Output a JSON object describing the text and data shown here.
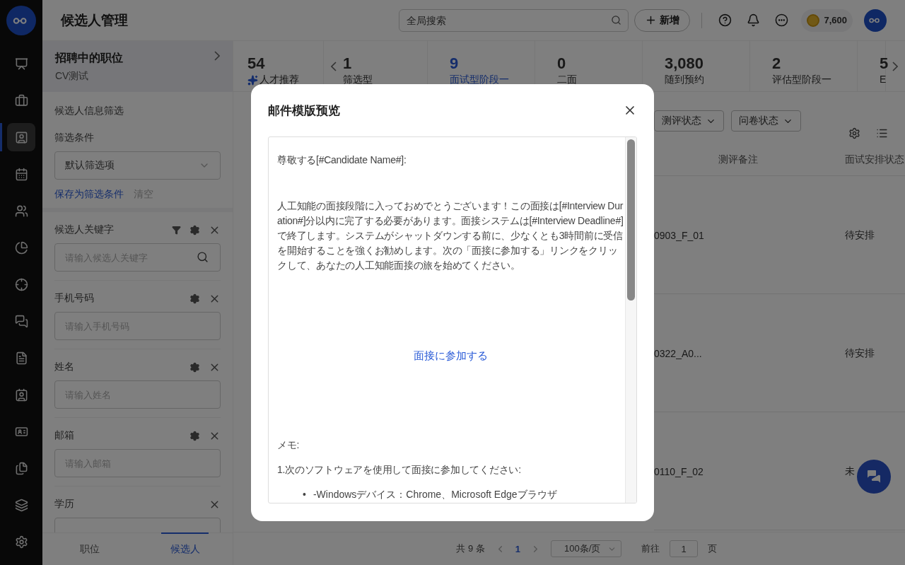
{
  "rail": {
    "items": [
      {
        "selected": false
      },
      {
        "selected": false
      },
      {
        "selected": true
      },
      {
        "selected": false
      },
      {
        "selected": false
      },
      {
        "selected": false
      },
      {
        "selected": false
      },
      {
        "selected": false
      },
      {
        "selected": false
      },
      {
        "selected": false
      },
      {
        "selected": false
      },
      {
        "selected": false
      },
      {
        "selected": false
      }
    ]
  },
  "header": {
    "title": "候选人管理",
    "search": {
      "placeholder": "全局搜索"
    },
    "add_button": "新增",
    "coins": "7,600"
  },
  "position_card": {
    "title": "招聘中的职位",
    "subtitle": "CV测试"
  },
  "filter_panel": {
    "heading": "候选人信息筛选",
    "condition_label": "筛选条件",
    "condition_select": "默认筛选项",
    "save_link": "保存为筛选条件",
    "clear_link": "清空",
    "fields": [
      {
        "label": "候选人关键字",
        "placeholder": "请输入候选人关键字",
        "filter_icon": true,
        "settings_icon": true,
        "search_icon": true
      },
      {
        "label": "手机号码",
        "placeholder": "请输入手机号码",
        "filter_icon": false,
        "settings_icon": true,
        "search_icon": false
      },
      {
        "label": "姓名",
        "placeholder": "请输入姓名",
        "filter_icon": false,
        "settings_icon": true,
        "search_icon": false
      },
      {
        "label": "邮箱",
        "placeholder": "请输入邮箱",
        "filter_icon": false,
        "settings_icon": true,
        "search_icon": false
      },
      {
        "label": "学历",
        "filter_icon": false,
        "settings_icon": false,
        "search_icon": false
      }
    ]
  },
  "panel_tabs": [
    {
      "label": "职位",
      "selected": false
    },
    {
      "label": "候选人",
      "selected": true
    }
  ],
  "stages": [
    {
      "count": "54",
      "label": "人才推荐",
      "kind": "recommend",
      "selected": false
    },
    {
      "count": "1",
      "label": "筛选型",
      "kind": "plain",
      "selected": false
    },
    {
      "count": "9",
      "label": "面试型阶段一",
      "kind": "plain",
      "selected": true
    },
    {
      "count": "0",
      "label": "二面",
      "kind": "plain",
      "selected": false
    },
    {
      "count": "3,080",
      "label": "随到预约",
      "kind": "plain",
      "selected": false
    },
    {
      "count": "2",
      "label": "评估型阶段一",
      "kind": "plain",
      "selected": false
    },
    {
      "count": "5",
      "label": "E",
      "kind": "plain",
      "selected": false
    }
  ],
  "filters": [
    "测评状态",
    "问卷状态"
  ],
  "table": {
    "columns": [
      "测评备注",
      "面试安排状态"
    ],
    "rows": [
      {
        "column_1": "0903_F_01",
        "status": "待安排"
      },
      {
        "column_1": "0322_A0...",
        "status": "待安排"
      },
      {
        "column_1": "0110_F_02",
        "status": "未"
      }
    ]
  },
  "pagination": {
    "total": "共 9 条",
    "page": "1",
    "page_size": "100条/页",
    "goto_label": "前往",
    "goto_value": "1",
    "page_suffix": "页"
  },
  "modal": {
    "title": "邮件模版预览",
    "blocks": [
      {
        "kind": "greeting",
        "text": "尊敬する[#Candidate Name#]:"
      },
      {
        "kind": "body",
        "text": "人工知能の面接段階に入っておめでとうございます！この面接は[#Interview Duration#]分以内に完了する必要があります。面接システムは[#Interview Deadline#]で終了します。システムがシャットダウンする前に、少なくとも3時間前に受信を開始することを強くお勧めします。次の「面接に参加する」リンクをクリックして、あなたの人工知能面接の旅を始めてください。"
      },
      {
        "kind": "link",
        "text": "面接に参加する"
      },
      {
        "kind": "memo",
        "text": "メモ:"
      },
      {
        "kind": "note",
        "text": "1.次のソフトウェアを使用して面接に参加してください:"
      },
      {
        "kind": "bullet",
        "marker": "•",
        "text": "-Windowsデバイス：Chrome、Microsoft Edgeブラウザ"
      }
    ]
  }
}
